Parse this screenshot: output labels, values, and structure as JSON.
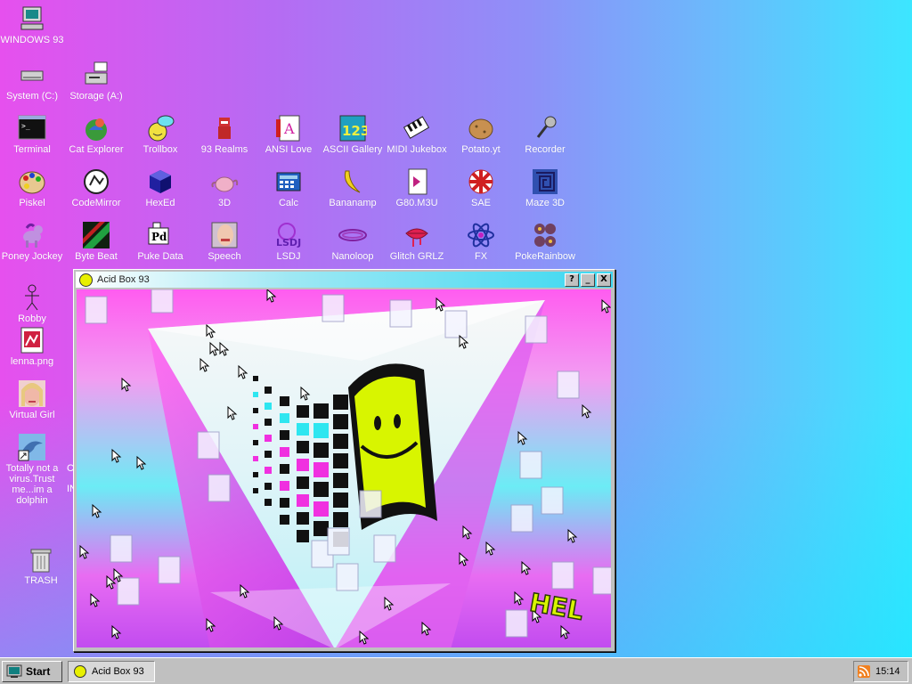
{
  "desktop": {
    "icons": {
      "windows93": "WINDOWS 93",
      "system_c": "System (C:)",
      "storage_a": "Storage (A:)",
      "terminal": "Terminal",
      "cat_explorer": "Cat Explorer",
      "trollbox": "Trollbox",
      "realms": "93 Realms",
      "ansi_love": "ANSI Love",
      "ascii_gallery": "ASCII Gallery",
      "midi_jukebox": "MIDI Jukebox",
      "potato": "Potato.yt",
      "recorder": "Recorder",
      "piskel": "Piskel",
      "codemirror": "CodeMirror",
      "hexed": "HexEd",
      "three_d": "3D",
      "calc": "Calc",
      "bananamp": "Bananamp",
      "g80": "G80.M3U",
      "sae": "SAE",
      "maze3d": "Maze 3D",
      "poney": "Poney Jockey",
      "bytebeat": "Byte Beat",
      "puke": "Puke Data",
      "speech": "Speech",
      "lsdj": "LSDJ",
      "nanoloop": "Nanoloop",
      "glitch": "Glitch GRLZ",
      "fx": "FX",
      "pokerainbow": "PokeRainbow",
      "robby": "Robby",
      "lenna": "lenna.png",
      "virtual_girl": "Virtual Girl",
      "dolphin": "Totally not a virus.Trust me...im a dolphin",
      "trash": "TRASH"
    },
    "cut_off_labels": {
      "c": "C",
      "in": "IN"
    }
  },
  "window": {
    "title": "Acid Box 93",
    "help": "?",
    "minimize": "_",
    "close": "X",
    "banner": "HEL"
  },
  "taskbar": {
    "start": "Start",
    "task": "Acid Box 93",
    "clock": "15:14"
  }
}
